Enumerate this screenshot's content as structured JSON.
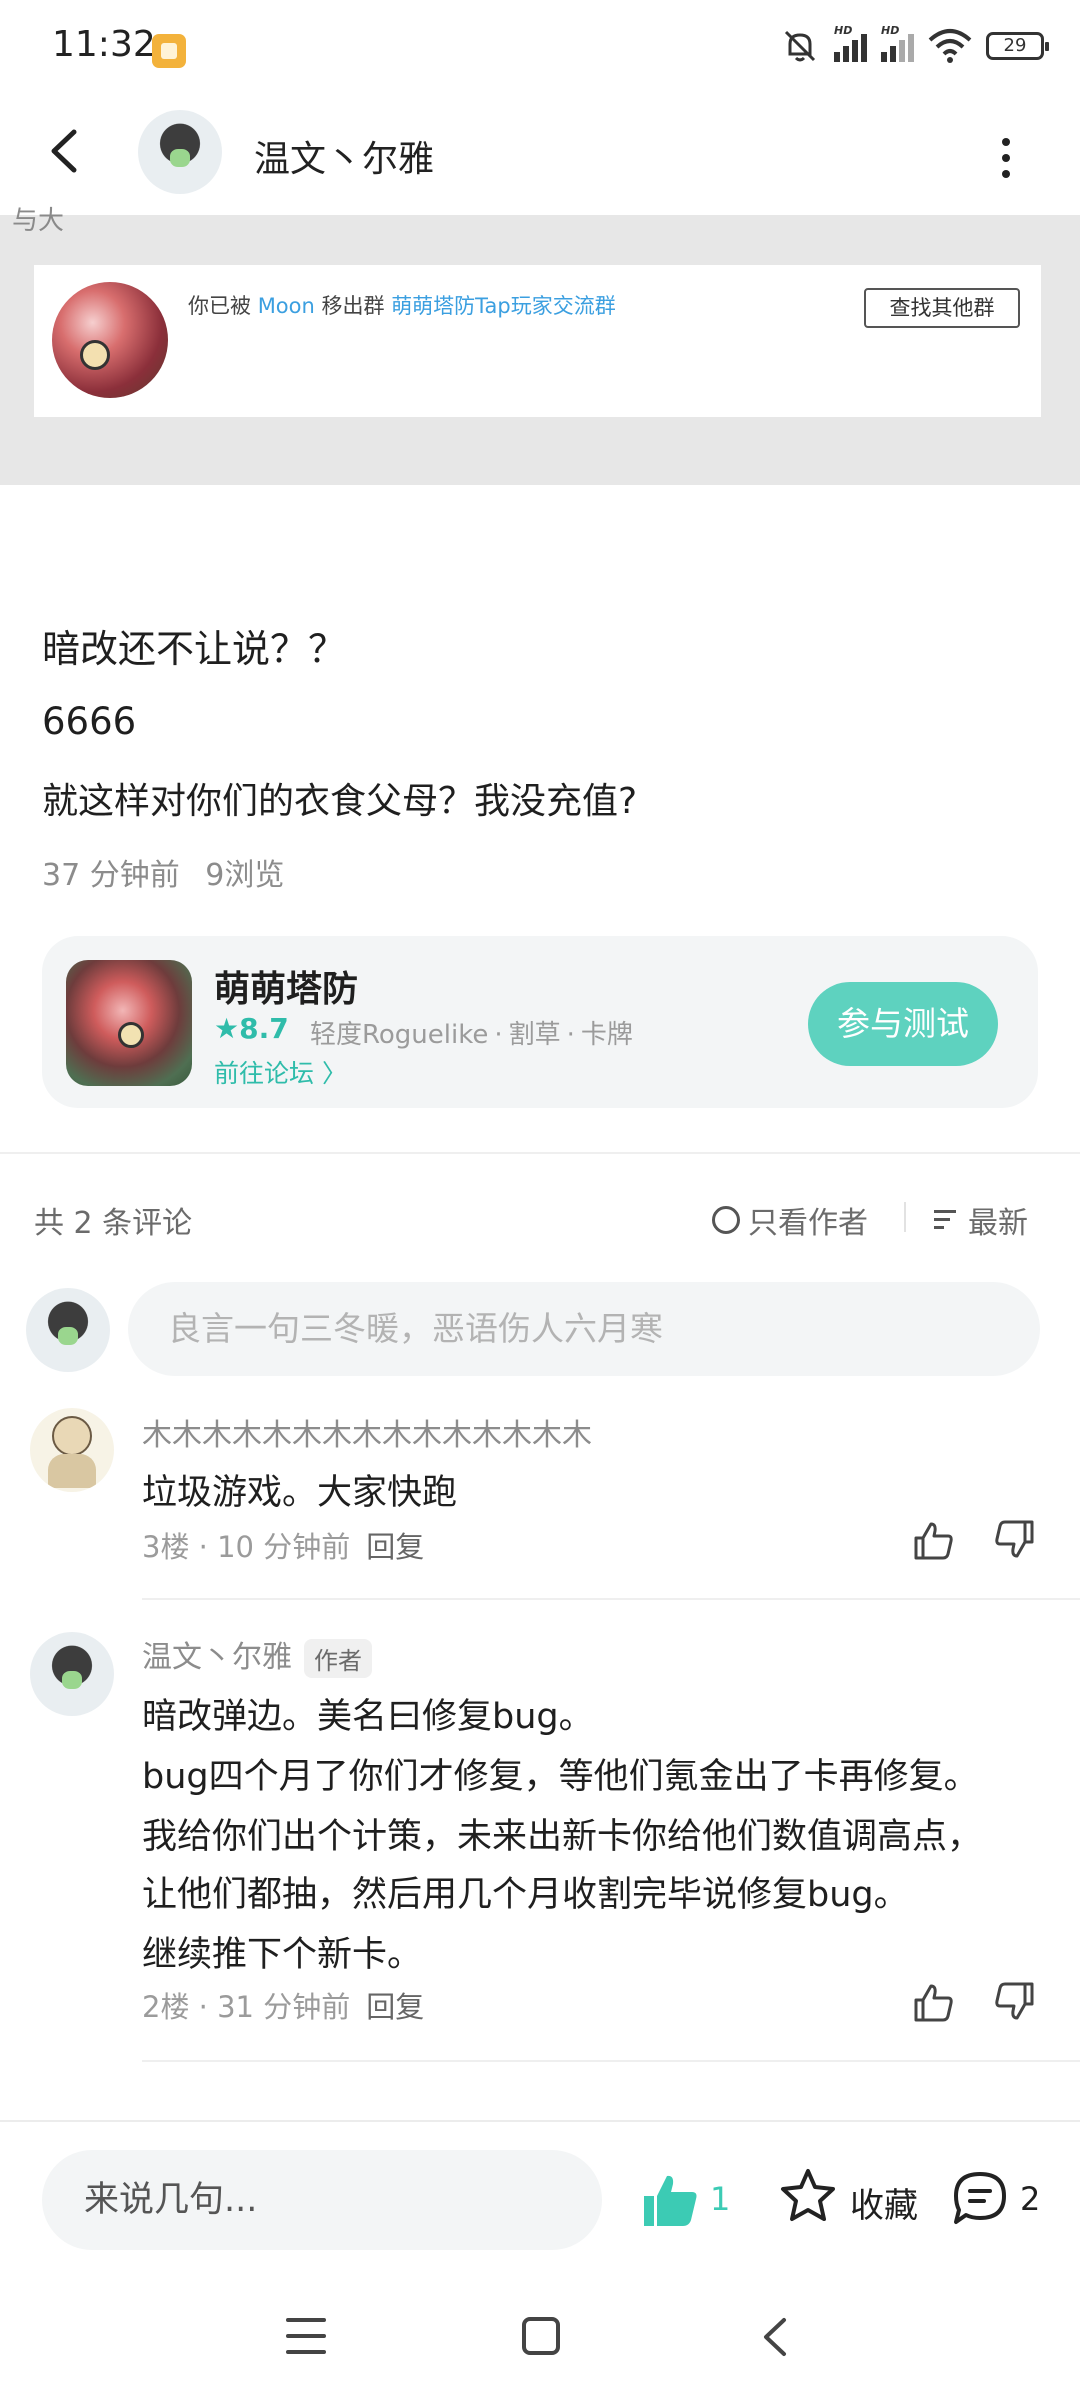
{
  "status_bar": {
    "time": "11:32",
    "hd1": "HD",
    "hd2": "HD",
    "battery": "29"
  },
  "header": {
    "user_name": "温文丶尔雅"
  },
  "screenshot": {
    "cut_text": "与大",
    "kick_prefix": "你已被",
    "kick_user": "Moon",
    "kick_mid": "移出群",
    "kick_group": "萌萌塔防Tap玩家交流群",
    "find_button": "查找其他群"
  },
  "post": {
    "title": "暗改还不让说？？",
    "line2": "6666",
    "line3": "就这样对你们的衣食父母？我没充值?",
    "time": "37 分钟前",
    "views": "9浏览"
  },
  "game": {
    "name": "萌萌塔防",
    "rating": "★8.7",
    "tags": [
      "轻度Roguelike",
      "·",
      "割草",
      "·",
      "卡牌"
    ],
    "forum_link": "前往论坛 〉",
    "join_button": "参与测试"
  },
  "comments_header": {
    "count": "共 2 条评论",
    "only_author": "只看作者",
    "sort": "最新"
  },
  "comment_input": {
    "placeholder": "良言一句三冬暖，恶语伤人六月寒"
  },
  "comments": [
    {
      "user": "木木木木木木木木木木木木木木木",
      "text": "垃圾游戏。大家快跑",
      "meta": "3楼 · 10 分钟前",
      "reply": "回复"
    },
    {
      "user": "温文丶尔雅",
      "tag": "作者",
      "lines": [
        "暗改弹边。美名曰修复bug。",
        "bug四个月了你们才修复，等他们氪金出了卡再修复。",
        "我给你们出个计策，未来出新卡你给他们数值调高点，",
        "让他们都抽，然后用几个月收割完毕说修复bug。",
        "继续推下个新卡。"
      ],
      "meta": "2楼 · 31 分钟前",
      "reply": "回复"
    }
  ],
  "bottom_bar": {
    "input_placeholder": "来说几句...",
    "like_count": "1",
    "collect_label": "收藏",
    "comment_count": "2"
  },
  "colors": {
    "accent": "#5ed2bf",
    "teal_text": "#2fbcaa",
    "link_blue": "#3b9fe0"
  }
}
